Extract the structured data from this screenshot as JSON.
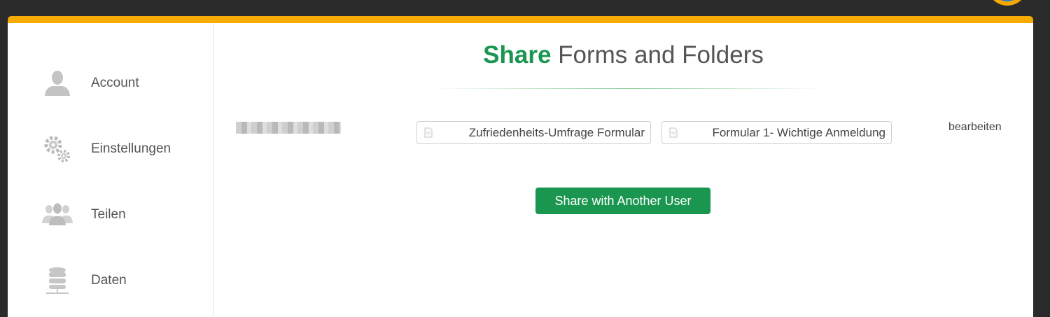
{
  "colors": {
    "accent_orange": "#f7ab00",
    "brand_green": "#1a9650",
    "background": "#2b2b2b"
  },
  "sidebar": {
    "items": [
      {
        "label": "Account",
        "icon": "user-icon"
      },
      {
        "label": "Einstellungen",
        "icon": "gears-icon"
      },
      {
        "label": "Teilen",
        "icon": "users-icon"
      },
      {
        "label": "Daten",
        "icon": "database-icon"
      }
    ]
  },
  "main": {
    "title_accent": "Share",
    "title_rest": " Forms and Folders",
    "shared_forms": [
      {
        "label": "Zufriedenheits-Umfrage Formular",
        "icon": "document-icon"
      },
      {
        "label": "Formular 1- Wichtige Anmeldung",
        "icon": "document-icon"
      }
    ],
    "permission_label": "bearbeiten",
    "share_button_label": "Share with Another User"
  }
}
